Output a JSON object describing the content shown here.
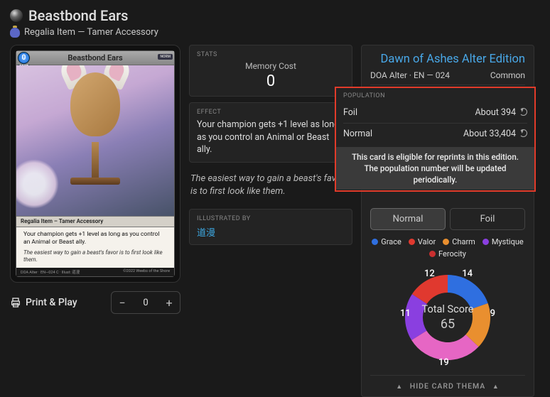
{
  "header": {
    "title": "Beastbond Ears",
    "subtitle": "Regalia Item — Tamer Accessory"
  },
  "card": {
    "name": "Beastbond Ears",
    "cost": "0",
    "cost_label": "COST",
    "norm_tag": "NORM",
    "type_line": "Regalia Item – Tamer Accessory",
    "rules": "Your champion gets +1 level as long as you control an Animal or Beast ally.",
    "flavor": "The easiest way to gain a beast's favor is to first look like them.",
    "footer_left": "DOA Alter · EN—024 C · Illust: 道漫",
    "footer_right": "©2022 Weebs of the Shore"
  },
  "print_play": {
    "label": "Print & Play",
    "qty": "0"
  },
  "stats": {
    "header": "STATS",
    "memory_label": "Memory Cost",
    "memory_value": "0"
  },
  "effect": {
    "header": "EFFECT",
    "text": "Your champion gets +1 level as long as you control an Animal or Beast ally."
  },
  "flavor_panel": "The easiest way to gain a beast's favor is to first look like them.",
  "illustrated": {
    "header": "ILLUSTRATED BY",
    "name": "道漫"
  },
  "edition": {
    "title": "Dawn of Ashes Alter Edition",
    "code": "DOA Alter · EN — 024",
    "rarity": "Common"
  },
  "population": {
    "header": "POPULATION",
    "rows": [
      {
        "label": "Foil",
        "value": "About 394"
      },
      {
        "label": "Normal",
        "value": "About 33,404"
      }
    ],
    "note_line1": "This card is eligible for reprints in this edition.",
    "note_line2": "The population number will be updated periodically."
  },
  "toggles": {
    "normal": "Normal",
    "foil": "Foil"
  },
  "thema": {
    "legend": [
      {
        "name": "Grace",
        "color": "#2f6fe0"
      },
      {
        "name": "Valor",
        "color": "#e0392f"
      },
      {
        "name": "Charm",
        "color": "#e98f2f"
      },
      {
        "name": "Mystique",
        "color": "#8a3fe0"
      },
      {
        "name": "Ferocity",
        "color": "#c92f2f"
      }
    ],
    "scores": {
      "grace": 14,
      "valor": 12,
      "charm": 9,
      "mystique": 11,
      "ferocity": 19
    },
    "total_label": "Total Score",
    "total_value": "65",
    "hide_label": "HIDE CARD THEMA"
  },
  "chart_data": {
    "type": "pie",
    "title": "Total Score",
    "series": [
      {
        "name": "Grace",
        "value": 14,
        "color": "#2f6fe0"
      },
      {
        "name": "Valor",
        "value": 12,
        "color": "#e0392f"
      },
      {
        "name": "Charm",
        "value": 9,
        "color": "#e98f2f"
      },
      {
        "name": "Mystique",
        "value": 11,
        "color": "#8a3fe0"
      },
      {
        "name": "Ferocity",
        "value": 19,
        "color": "#c92f2f"
      }
    ],
    "total": 65
  }
}
